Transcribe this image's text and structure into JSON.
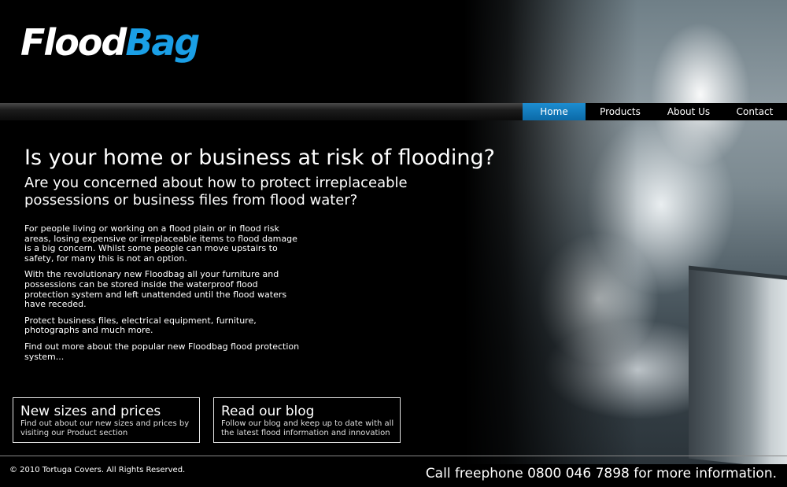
{
  "logo": {
    "part1": "Flood",
    "part2": "Bag"
  },
  "nav": [
    {
      "label": "Home",
      "active": true
    },
    {
      "label": "Products",
      "active": false
    },
    {
      "label": "About Us",
      "active": false
    },
    {
      "label": "Contact",
      "active": false
    }
  ],
  "hero": {
    "headline": "Is your home or business at risk of flooding?",
    "subheadline": "Are you concerned about how to protect irreplaceable possessions or business files from flood water?"
  },
  "body": [
    "For people living or working on a flood plain or in flood risk areas, losing expensive or irreplaceable items to flood damage is a big concern. Whilst some people can move upstairs to safety, for many this is not an option.",
    "With the revolutionary new Floodbag all your furniture and possessions can be stored inside the waterproof flood protection system and left unattended until the flood waters have receded.",
    "Protect business files, electrical equipment, furniture, photographs and much more.",
    "Find out more about the popular new Floodbag flood protection system..."
  ],
  "promos": [
    {
      "title": "New sizes and prices",
      "text": "Find out about our new sizes and prices by visiting our Product section"
    },
    {
      "title": "Read our blog",
      "text": "Follow our blog and keep up to date with all the latest flood information and innovation"
    }
  ],
  "footer": {
    "copyright": "© 2010 Tortuga Covers. All Rights Reserved.",
    "call": "Call freephone 0800 046 7898 for more information."
  },
  "colors": {
    "accent": "#1a9fe6",
    "nav_active": "#0b6aa8",
    "background": "#000000"
  }
}
